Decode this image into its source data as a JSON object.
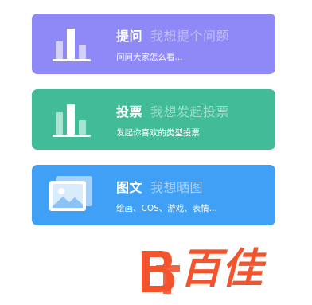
{
  "cards": [
    {
      "title": "提问",
      "hint": "我想提个问题",
      "subtitle": "问问大家怎么看...",
      "icon": "bar-chart-icon",
      "color": "#8f88f7",
      "hint_color": "#c2bdfb"
    },
    {
      "title": "投票",
      "hint": "我想发起投票",
      "subtitle": "发起你喜欢的类型投票",
      "icon": "bar-chart-icon",
      "color": "#41bb98",
      "hint_color": "#9adcc7"
    },
    {
      "title": "图文",
      "hint": "我想晒图",
      "subtitle": "绘画、COS、游戏、表情...",
      "icon": "image-icon",
      "color": "#3fa0f6",
      "hint_color": "#a7d0fb"
    }
  ],
  "watermark": {
    "text": "百佳",
    "logo_letters": "BT",
    "color": "#f2542e"
  }
}
